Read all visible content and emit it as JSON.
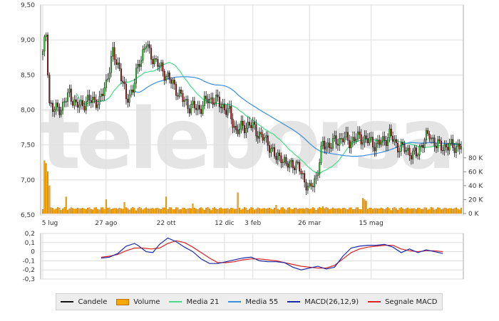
{
  "chart_data": [
    {
      "type": "candlestick",
      "watermark": "teleborsa",
      "ylim": [
        6.5,
        9.5
      ],
      "y_ticks": [
        "9,50",
        "9,00",
        "8,50",
        "8,00",
        "7,50",
        "7,00",
        "6,50"
      ],
      "x_ticks": [
        "5 lug",
        "27 ago",
        "22 ott",
        "12 dic",
        "3 feb",
        "26 mar",
        "15 mag"
      ],
      "volume_ticks": [
        "80 K",
        "60 K",
        "40 K",
        "20 K",
        "0 K"
      ],
      "volume_max_k": 90,
      "n_days": 252,
      "x_tick_days": [
        0,
        38,
        74,
        109,
        126,
        160,
        197
      ],
      "anchors": [
        [
          0,
          8.8
        ],
        [
          2,
          9.1
        ],
        [
          4,
          8.1
        ],
        [
          6,
          8.0
        ],
        [
          12,
          8.05
        ],
        [
          16,
          8.25
        ],
        [
          20,
          8.05
        ],
        [
          25,
          8.1
        ],
        [
          30,
          8.15
        ],
        [
          34,
          8.1
        ],
        [
          38,
          8.4
        ],
        [
          42,
          8.8
        ],
        [
          46,
          8.6
        ],
        [
          50,
          8.15
        ],
        [
          54,
          8.3
        ],
        [
          58,
          8.7
        ],
        [
          62,
          8.95
        ],
        [
          64,
          8.8
        ],
        [
          66,
          8.75
        ],
        [
          70,
          8.62
        ],
        [
          74,
          8.5
        ],
        [
          80,
          8.3
        ],
        [
          84,
          8.15
        ],
        [
          88,
          8.05
        ],
        [
          94,
          8.02
        ],
        [
          99,
          8.15
        ],
        [
          103,
          8.15
        ],
        [
          108,
          8.05
        ],
        [
          112,
          7.95
        ],
        [
          116,
          7.7
        ],
        [
          120,
          7.75
        ],
        [
          124,
          7.8
        ],
        [
          128,
          7.7
        ],
        [
          132,
          7.6
        ],
        [
          136,
          7.5
        ],
        [
          140,
          7.3
        ],
        [
          143,
          7.35
        ],
        [
          146,
          7.2
        ],
        [
          150,
          7.25
        ],
        [
          154,
          7.15
        ],
        [
          158,
          6.95
        ],
        [
          160,
          6.85
        ],
        [
          164,
          7.05
        ],
        [
          168,
          7.5
        ],
        [
          172,
          7.5
        ],
        [
          176,
          7.55
        ],
        [
          180,
          7.6
        ],
        [
          184,
          7.55
        ],
        [
          188,
          7.6
        ],
        [
          192,
          7.6
        ],
        [
          196,
          7.55
        ],
        [
          200,
          7.5
        ],
        [
          204,
          7.55
        ],
        [
          208,
          7.65
        ],
        [
          212,
          7.5
        ],
        [
          216,
          7.45
        ],
        [
          220,
          7.4
        ],
        [
          224,
          7.35
        ],
        [
          228,
          7.55
        ],
        [
          232,
          7.65
        ],
        [
          236,
          7.5
        ],
        [
          238,
          7.48
        ]
      ],
      "volume_spikes": [
        [
          1,
          76
        ],
        [
          2,
          72
        ],
        [
          3,
          60
        ],
        [
          4,
          40
        ],
        [
          14,
          24
        ],
        [
          38,
          20
        ],
        [
          49,
          16
        ],
        [
          74,
          24
        ],
        [
          90,
          14
        ],
        [
          117,
          30
        ],
        [
          140,
          12
        ],
        [
          168,
          10
        ],
        [
          192,
          22
        ],
        [
          193,
          20
        ],
        [
          194,
          18
        ]
      ],
      "macd_ylim": [
        -0.3,
        0.2
      ],
      "macd_ticks": [
        "0,2",
        "0,1",
        "0",
        "-0,1",
        "-0,2",
        "-0,3"
      ],
      "macd": {
        "x": [
          35,
          40,
          45,
          50,
          55,
          57,
          62,
          66,
          70,
          75,
          80,
          85,
          90,
          95,
          100,
          105,
          110,
          115,
          120,
          125,
          130,
          135,
          140,
          145,
          150,
          155,
          160,
          165,
          170,
          175,
          180,
          185,
          190,
          195,
          200,
          205,
          210,
          215,
          220,
          225,
          230,
          235,
          240
        ],
        "values": [
          -0.07,
          -0.06,
          -0.02,
          0.06,
          0.09,
          0.07,
          0.0,
          -0.01,
          0.08,
          0.15,
          0.11,
          0.05,
          0.0,
          -0.08,
          -0.13,
          -0.13,
          -0.11,
          -0.09,
          -0.07,
          -0.06,
          -0.1,
          -0.11,
          -0.11,
          -0.12,
          -0.17,
          -0.2,
          -0.18,
          -0.16,
          -0.19,
          -0.17,
          -0.05,
          0.04,
          0.06,
          0.07,
          0.07,
          0.08,
          0.05,
          -0.01,
          0.03,
          -0.01,
          0.02,
          0.0,
          -0.02
        ]
      },
      "signal": {
        "x": [
          35,
          40,
          45,
          50,
          55,
          60,
          65,
          70,
          75,
          80,
          85,
          90,
          95,
          100,
          105,
          110,
          115,
          120,
          125,
          130,
          135,
          140,
          145,
          150,
          155,
          160,
          165,
          170,
          175,
          180,
          185,
          190,
          195,
          200,
          205,
          210,
          215,
          220,
          225,
          230,
          235,
          240
        ],
        "values": [
          -0.06,
          -0.05,
          -0.03,
          0.01,
          0.04,
          0.04,
          0.03,
          0.04,
          0.09,
          0.12,
          0.1,
          0.05,
          -0.01,
          -0.07,
          -0.12,
          -0.12,
          -0.11,
          -0.09,
          -0.08,
          -0.08,
          -0.09,
          -0.1,
          -0.12,
          -0.14,
          -0.16,
          -0.17,
          -0.18,
          -0.18,
          -0.15,
          -0.08,
          -0.01,
          0.03,
          0.05,
          0.06,
          0.07,
          0.07,
          0.03,
          0.01,
          0.0,
          0.01,
          0.01,
          0.0
        ]
      },
      "colors": {
        "candle": "#111111",
        "up_fill": "#33cc33",
        "down_fill": "#a01818",
        "volume": "#f6a800",
        "ma21": "#44dd88",
        "ma55": "#3a8ee0",
        "macd": "#1a2aa8",
        "signal": "#dd2222"
      },
      "legend": [
        {
          "label": "Candele",
          "kind": "line",
          "color": "#111111"
        },
        {
          "label": "Volume",
          "kind": "box",
          "color": "#f6a800"
        },
        {
          "label": "Media 21",
          "kind": "line",
          "color": "#44dd88"
        },
        {
          "label": "Media 55",
          "kind": "line",
          "color": "#3a8ee0"
        },
        {
          "label": "MACD(26,12,9)",
          "kind": "line",
          "color": "#1a2aa8"
        },
        {
          "label": "Segnale MACD",
          "kind": "line",
          "color": "#dd2222"
        }
      ]
    }
  ]
}
